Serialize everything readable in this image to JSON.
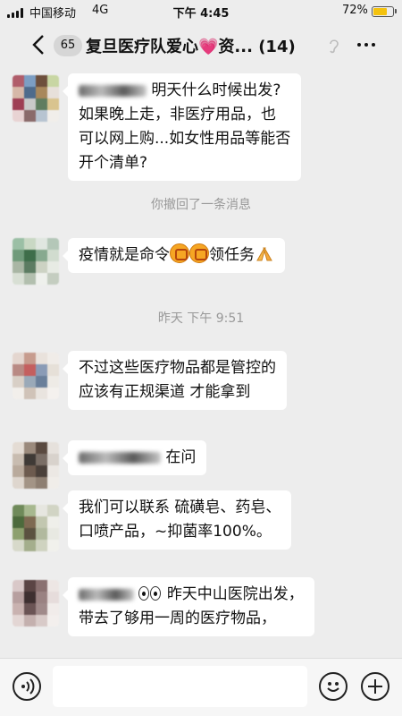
{
  "status_bar": {
    "carrier": "中国移动",
    "network": "4G",
    "time": "下午 4:45",
    "battery_percent": "72%",
    "battery_level": 0.72
  },
  "nav": {
    "unread_count": "65",
    "title_part1": "复旦医疗队爱心",
    "title_part2": "资... (14)",
    "heart_emoji": "💗",
    "icons": [
      "back-icon",
      "earpiece-mode-icon",
      "more-icon"
    ]
  },
  "messages": [
    {
      "text_line1": "明天什么时候出发?",
      "text_line2": "如果晚上走，非医疗用品，也",
      "text_line3": "可以网上购...如女性用品等能否",
      "text_line4": "开个清单?"
    },
    {
      "system": "你撤回了一条消息"
    },
    {
      "text": "疫情就是命令",
      "text_tail": "领任务"
    },
    {
      "timestamp": "昨天 下午 9:51"
    },
    {
      "text_line1": "不过这些医疗物品都是管控的",
      "text_line2": "应该有正规渠道  才能拿到"
    },
    {
      "text": "在问"
    },
    {
      "text_line1": "我们可以联系 硫磺皂、药皂、",
      "text_line2": "口喷产品，~抑菌率100%。"
    },
    {
      "text_line1": "昨天中山医院出发，",
      "text_line2": "带去了够用一周的医疗物品，"
    }
  ],
  "input_bar": {
    "placeholder": "",
    "icons": [
      "voice-icon",
      "emoji-icon",
      "plus-icon"
    ]
  }
}
